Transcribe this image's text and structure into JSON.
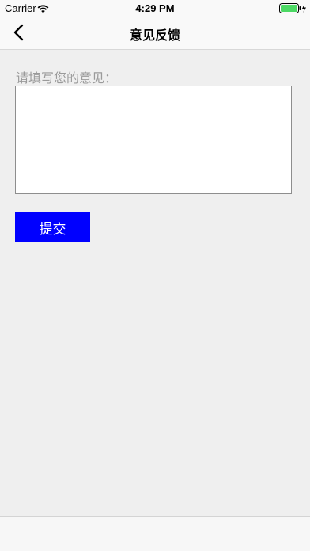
{
  "status_bar": {
    "carrier": "Carrier",
    "time": "4:29 PM",
    "wifi_icon": "wifi-icon",
    "battery_icon": "battery-charging-icon",
    "battery_color": "#4cd964"
  },
  "nav": {
    "back_icon": "chevron-left-icon",
    "title": "意见反馈"
  },
  "form": {
    "label": "请填写您的意见：",
    "textarea_value": "",
    "submit_label": "提交",
    "submit_color": "#0000ff"
  }
}
